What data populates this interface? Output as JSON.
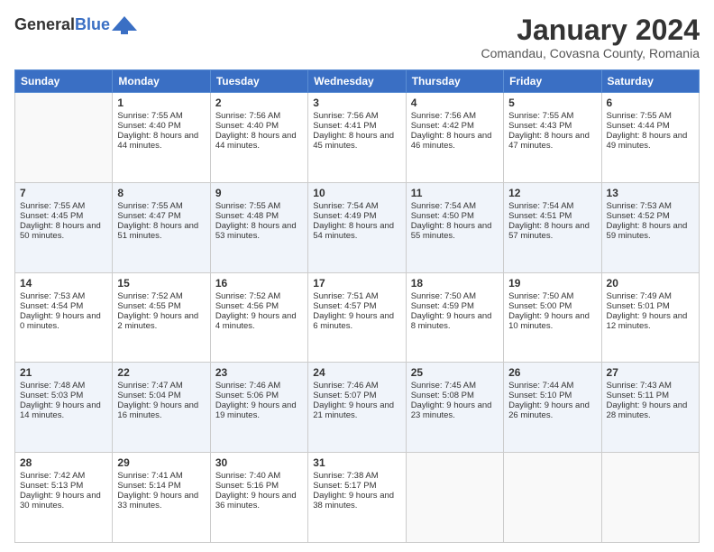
{
  "logo": {
    "general": "General",
    "blue": "Blue"
  },
  "title": "January 2024",
  "subtitle": "Comandau, Covasna County, Romania",
  "days": [
    "Sunday",
    "Monday",
    "Tuesday",
    "Wednesday",
    "Thursday",
    "Friday",
    "Saturday"
  ],
  "weeks": [
    [
      {
        "num": "",
        "sunrise": "",
        "sunset": "",
        "daylight": "",
        "empty": true
      },
      {
        "num": "1",
        "sunrise": "Sunrise: 7:55 AM",
        "sunset": "Sunset: 4:40 PM",
        "daylight": "Daylight: 8 hours and 44 minutes.",
        "empty": false
      },
      {
        "num": "2",
        "sunrise": "Sunrise: 7:56 AM",
        "sunset": "Sunset: 4:40 PM",
        "daylight": "Daylight: 8 hours and 44 minutes.",
        "empty": false
      },
      {
        "num": "3",
        "sunrise": "Sunrise: 7:56 AM",
        "sunset": "Sunset: 4:41 PM",
        "daylight": "Daylight: 8 hours and 45 minutes.",
        "empty": false
      },
      {
        "num": "4",
        "sunrise": "Sunrise: 7:56 AM",
        "sunset": "Sunset: 4:42 PM",
        "daylight": "Daylight: 8 hours and 46 minutes.",
        "empty": false
      },
      {
        "num": "5",
        "sunrise": "Sunrise: 7:55 AM",
        "sunset": "Sunset: 4:43 PM",
        "daylight": "Daylight: 8 hours and 47 minutes.",
        "empty": false
      },
      {
        "num": "6",
        "sunrise": "Sunrise: 7:55 AM",
        "sunset": "Sunset: 4:44 PM",
        "daylight": "Daylight: 8 hours and 49 minutes.",
        "empty": false
      }
    ],
    [
      {
        "num": "7",
        "sunrise": "Sunrise: 7:55 AM",
        "sunset": "Sunset: 4:45 PM",
        "daylight": "Daylight: 8 hours and 50 minutes.",
        "empty": false
      },
      {
        "num": "8",
        "sunrise": "Sunrise: 7:55 AM",
        "sunset": "Sunset: 4:47 PM",
        "daylight": "Daylight: 8 hours and 51 minutes.",
        "empty": false
      },
      {
        "num": "9",
        "sunrise": "Sunrise: 7:55 AM",
        "sunset": "Sunset: 4:48 PM",
        "daylight": "Daylight: 8 hours and 53 minutes.",
        "empty": false
      },
      {
        "num": "10",
        "sunrise": "Sunrise: 7:54 AM",
        "sunset": "Sunset: 4:49 PM",
        "daylight": "Daylight: 8 hours and 54 minutes.",
        "empty": false
      },
      {
        "num": "11",
        "sunrise": "Sunrise: 7:54 AM",
        "sunset": "Sunset: 4:50 PM",
        "daylight": "Daylight: 8 hours and 55 minutes.",
        "empty": false
      },
      {
        "num": "12",
        "sunrise": "Sunrise: 7:54 AM",
        "sunset": "Sunset: 4:51 PM",
        "daylight": "Daylight: 8 hours and 57 minutes.",
        "empty": false
      },
      {
        "num": "13",
        "sunrise": "Sunrise: 7:53 AM",
        "sunset": "Sunset: 4:52 PM",
        "daylight": "Daylight: 8 hours and 59 minutes.",
        "empty": false
      }
    ],
    [
      {
        "num": "14",
        "sunrise": "Sunrise: 7:53 AM",
        "sunset": "Sunset: 4:54 PM",
        "daylight": "Daylight: 9 hours and 0 minutes.",
        "empty": false
      },
      {
        "num": "15",
        "sunrise": "Sunrise: 7:52 AM",
        "sunset": "Sunset: 4:55 PM",
        "daylight": "Daylight: 9 hours and 2 minutes.",
        "empty": false
      },
      {
        "num": "16",
        "sunrise": "Sunrise: 7:52 AM",
        "sunset": "Sunset: 4:56 PM",
        "daylight": "Daylight: 9 hours and 4 minutes.",
        "empty": false
      },
      {
        "num": "17",
        "sunrise": "Sunrise: 7:51 AM",
        "sunset": "Sunset: 4:57 PM",
        "daylight": "Daylight: 9 hours and 6 minutes.",
        "empty": false
      },
      {
        "num": "18",
        "sunrise": "Sunrise: 7:50 AM",
        "sunset": "Sunset: 4:59 PM",
        "daylight": "Daylight: 9 hours and 8 minutes.",
        "empty": false
      },
      {
        "num": "19",
        "sunrise": "Sunrise: 7:50 AM",
        "sunset": "Sunset: 5:00 PM",
        "daylight": "Daylight: 9 hours and 10 minutes.",
        "empty": false
      },
      {
        "num": "20",
        "sunrise": "Sunrise: 7:49 AM",
        "sunset": "Sunset: 5:01 PM",
        "daylight": "Daylight: 9 hours and 12 minutes.",
        "empty": false
      }
    ],
    [
      {
        "num": "21",
        "sunrise": "Sunrise: 7:48 AM",
        "sunset": "Sunset: 5:03 PM",
        "daylight": "Daylight: 9 hours and 14 minutes.",
        "empty": false
      },
      {
        "num": "22",
        "sunrise": "Sunrise: 7:47 AM",
        "sunset": "Sunset: 5:04 PM",
        "daylight": "Daylight: 9 hours and 16 minutes.",
        "empty": false
      },
      {
        "num": "23",
        "sunrise": "Sunrise: 7:46 AM",
        "sunset": "Sunset: 5:06 PM",
        "daylight": "Daylight: 9 hours and 19 minutes.",
        "empty": false
      },
      {
        "num": "24",
        "sunrise": "Sunrise: 7:46 AM",
        "sunset": "Sunset: 5:07 PM",
        "daylight": "Daylight: 9 hours and 21 minutes.",
        "empty": false
      },
      {
        "num": "25",
        "sunrise": "Sunrise: 7:45 AM",
        "sunset": "Sunset: 5:08 PM",
        "daylight": "Daylight: 9 hours and 23 minutes.",
        "empty": false
      },
      {
        "num": "26",
        "sunrise": "Sunrise: 7:44 AM",
        "sunset": "Sunset: 5:10 PM",
        "daylight": "Daylight: 9 hours and 26 minutes.",
        "empty": false
      },
      {
        "num": "27",
        "sunrise": "Sunrise: 7:43 AM",
        "sunset": "Sunset: 5:11 PM",
        "daylight": "Daylight: 9 hours and 28 minutes.",
        "empty": false
      }
    ],
    [
      {
        "num": "28",
        "sunrise": "Sunrise: 7:42 AM",
        "sunset": "Sunset: 5:13 PM",
        "daylight": "Daylight: 9 hours and 30 minutes.",
        "empty": false
      },
      {
        "num": "29",
        "sunrise": "Sunrise: 7:41 AM",
        "sunset": "Sunset: 5:14 PM",
        "daylight": "Daylight: 9 hours and 33 minutes.",
        "empty": false
      },
      {
        "num": "30",
        "sunrise": "Sunrise: 7:40 AM",
        "sunset": "Sunset: 5:16 PM",
        "daylight": "Daylight: 9 hours and 36 minutes.",
        "empty": false
      },
      {
        "num": "31",
        "sunrise": "Sunrise: 7:38 AM",
        "sunset": "Sunset: 5:17 PM",
        "daylight": "Daylight: 9 hours and 38 minutes.",
        "empty": false
      },
      {
        "num": "",
        "sunrise": "",
        "sunset": "",
        "daylight": "",
        "empty": true
      },
      {
        "num": "",
        "sunrise": "",
        "sunset": "",
        "daylight": "",
        "empty": true
      },
      {
        "num": "",
        "sunrise": "",
        "sunset": "",
        "daylight": "",
        "empty": true
      }
    ]
  ]
}
